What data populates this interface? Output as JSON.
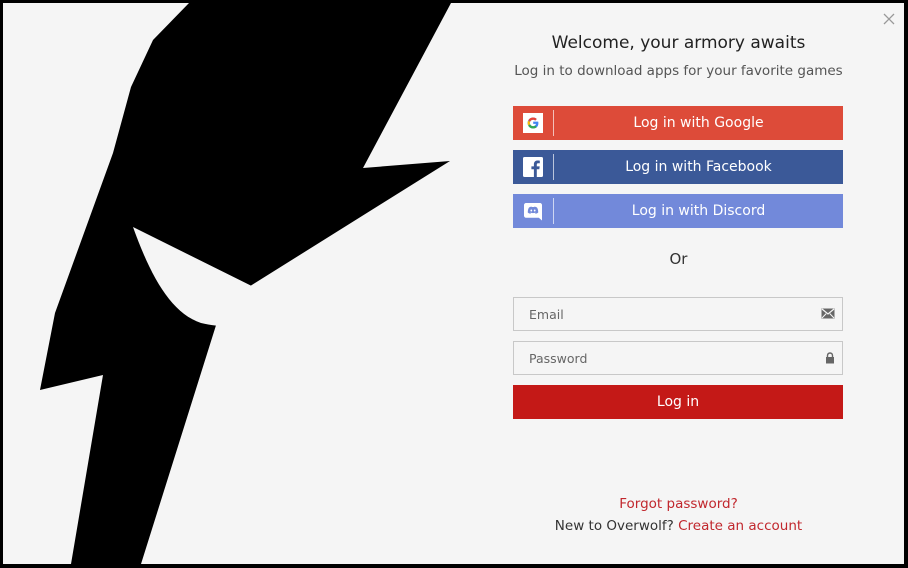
{
  "header": {
    "title": "Welcome, your armory awaits",
    "subtitle": "Log in to download apps for your favorite games"
  },
  "social": {
    "google_label": "Log in with Google",
    "facebook_label": "Log in with Facebook",
    "discord_label": "Log in with Discord",
    "google_color": "#dd4b39",
    "facebook_color": "#3b5998",
    "discord_color": "#7289da"
  },
  "divider": {
    "or_text": "Or"
  },
  "form": {
    "email_placeholder": "Email",
    "email_value": "",
    "password_placeholder": "Password",
    "password_value": "",
    "login_label": "Log in",
    "login_color": "#c41917"
  },
  "footer": {
    "forgot_password": "Forgot password?",
    "new_user_text": "New to Overwolf?",
    "create_account": "Create an account",
    "link_color": "#c1272d"
  },
  "icons": [
    "close-icon",
    "google-icon",
    "facebook-icon",
    "discord-icon",
    "envelope-icon",
    "lock-icon"
  ]
}
